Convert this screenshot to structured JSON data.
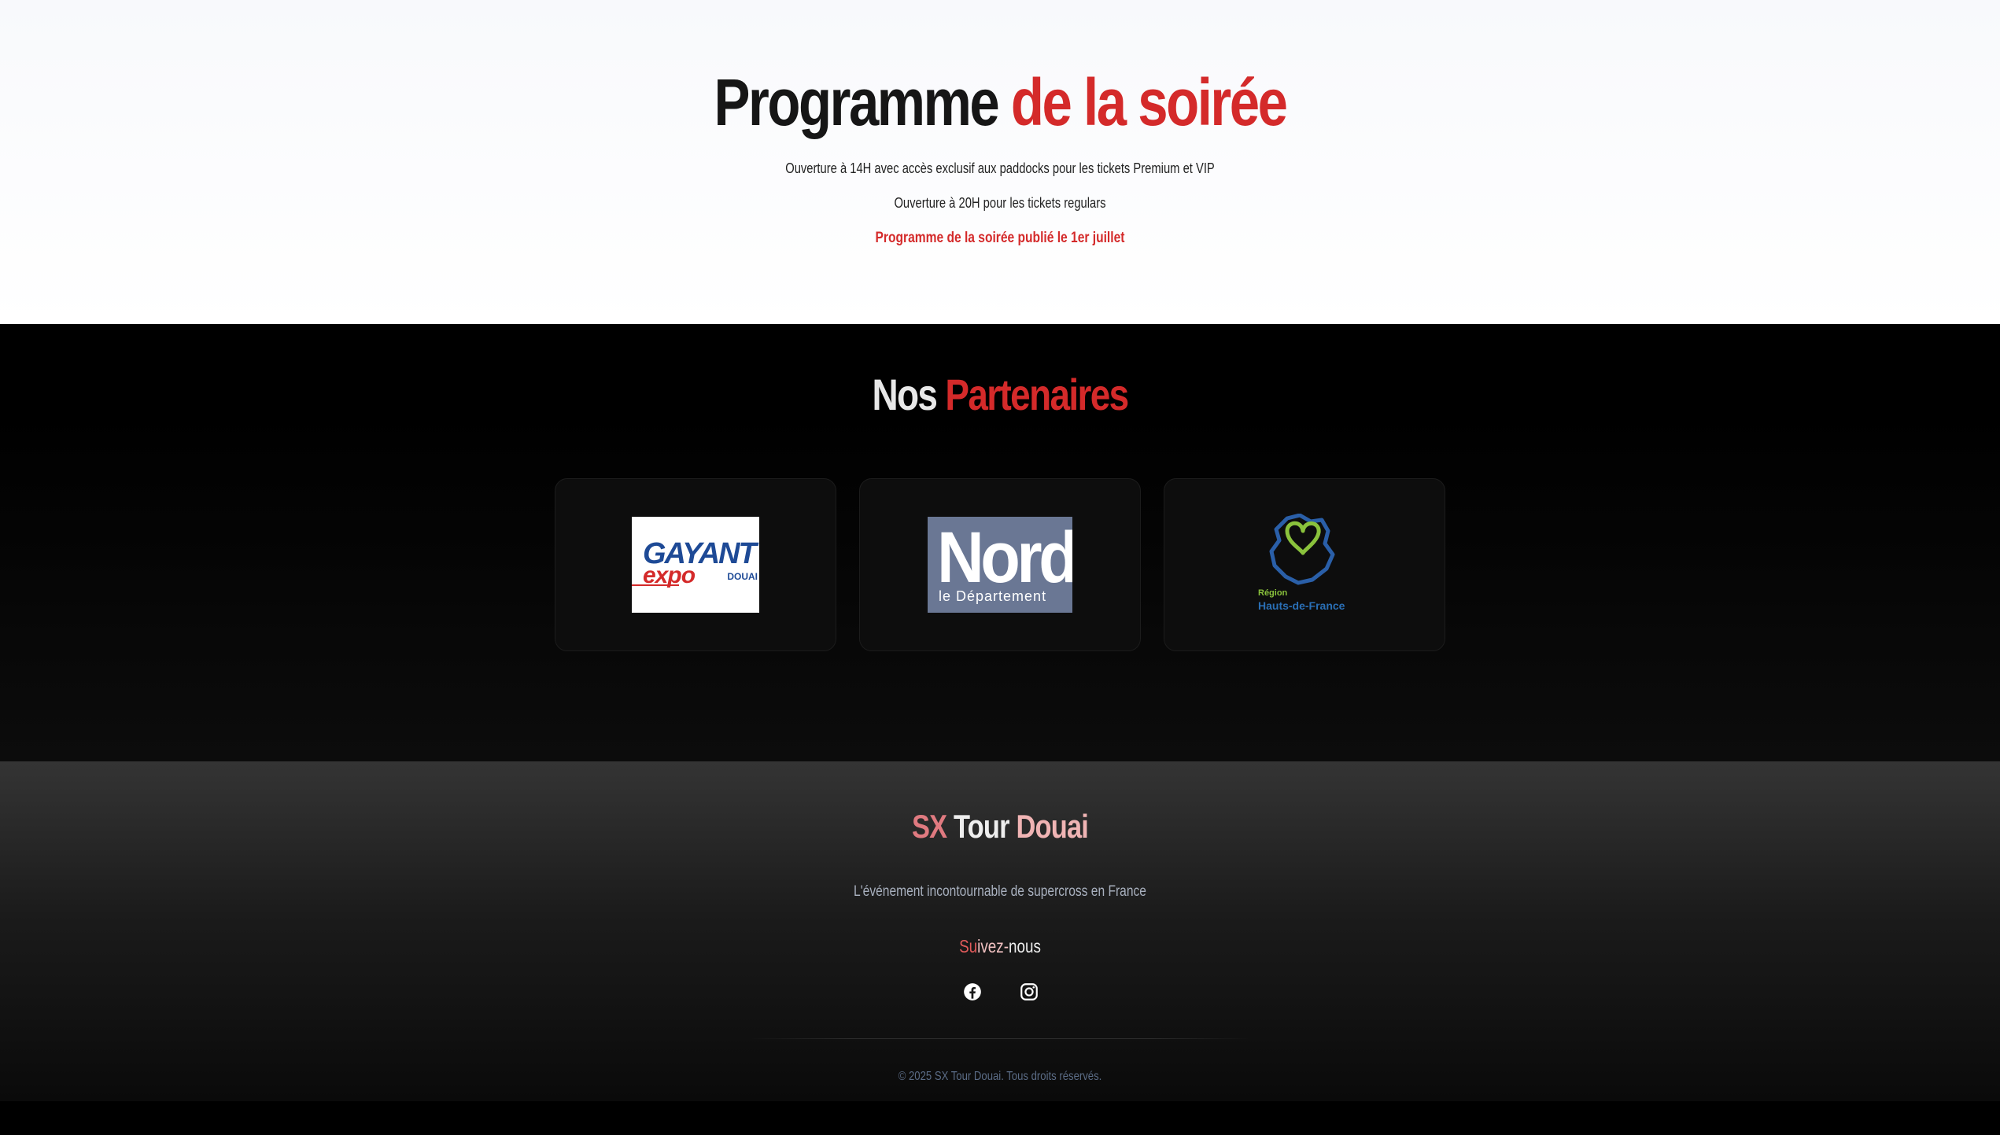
{
  "programme": {
    "title_part1": "Programme",
    "title_part2": "de la soirée",
    "line1": "Ouverture à 14H avec accès exclusif aux paddocks pour les tickets Premium et VIP",
    "line2": "Ouverture à 20H pour les tickets regulars",
    "line3": "Programme de la soirée publié le 1er juillet"
  },
  "partners": {
    "title_part1": "Nos",
    "title_part2": "Partenaires",
    "items": [
      {
        "logo_text_main": "GAYANT",
        "logo_text_sub": "expo",
        "logo_text_city": "DOUAI"
      },
      {
        "logo_text_main": "Nord",
        "logo_text_sub": "le Département"
      },
      {
        "logo_text_main": "Région",
        "logo_text_sub": "Hauts-de-France"
      }
    ]
  },
  "footer": {
    "brand_sx": "SX",
    "brand_tour": "Tour",
    "brand_douai": "Douai",
    "tagline": "L'événement incontournable de supercross en France",
    "follow_su": "Su",
    "follow_ivez": "ivez-",
    "follow_nous": "nous",
    "social_icons": [
      "facebook-icon",
      "instagram-icon"
    ],
    "copyright": "© 2025 SX Tour Douai. Tous droits réservés."
  },
  "colors": {
    "accent_red": "#d42a2a",
    "dark_bg": "#000000",
    "light_bg": "#f8f9fc"
  }
}
